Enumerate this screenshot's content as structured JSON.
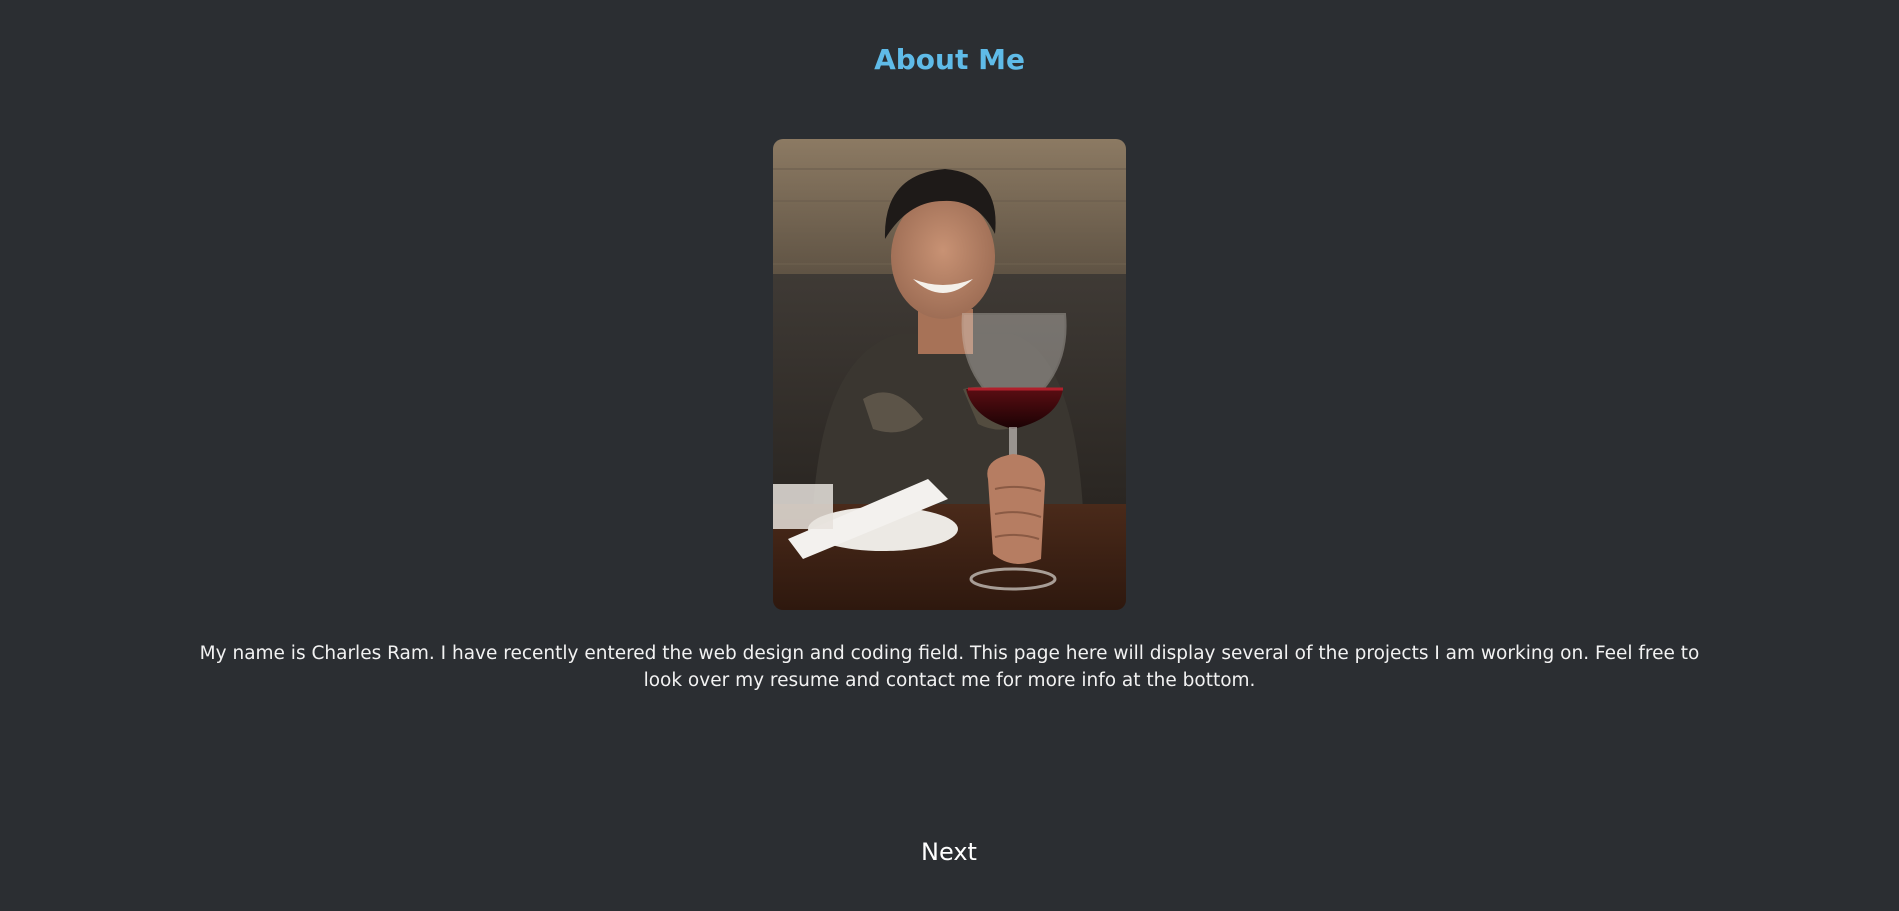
{
  "header": {
    "title": "About Me"
  },
  "profile": {
    "photo_description": "portrait-photo",
    "bio": "My name is Charles Ram. I have recently entered the web design and coding field. This page here will display several of the projects I am working on. Feel free to look over my resume and contact me for more info at the bottom."
  },
  "navigation": {
    "next_label": "Next"
  },
  "colors": {
    "background": "#2b2e32",
    "title": "#5fbbe8",
    "text": "#f2f2f2"
  }
}
